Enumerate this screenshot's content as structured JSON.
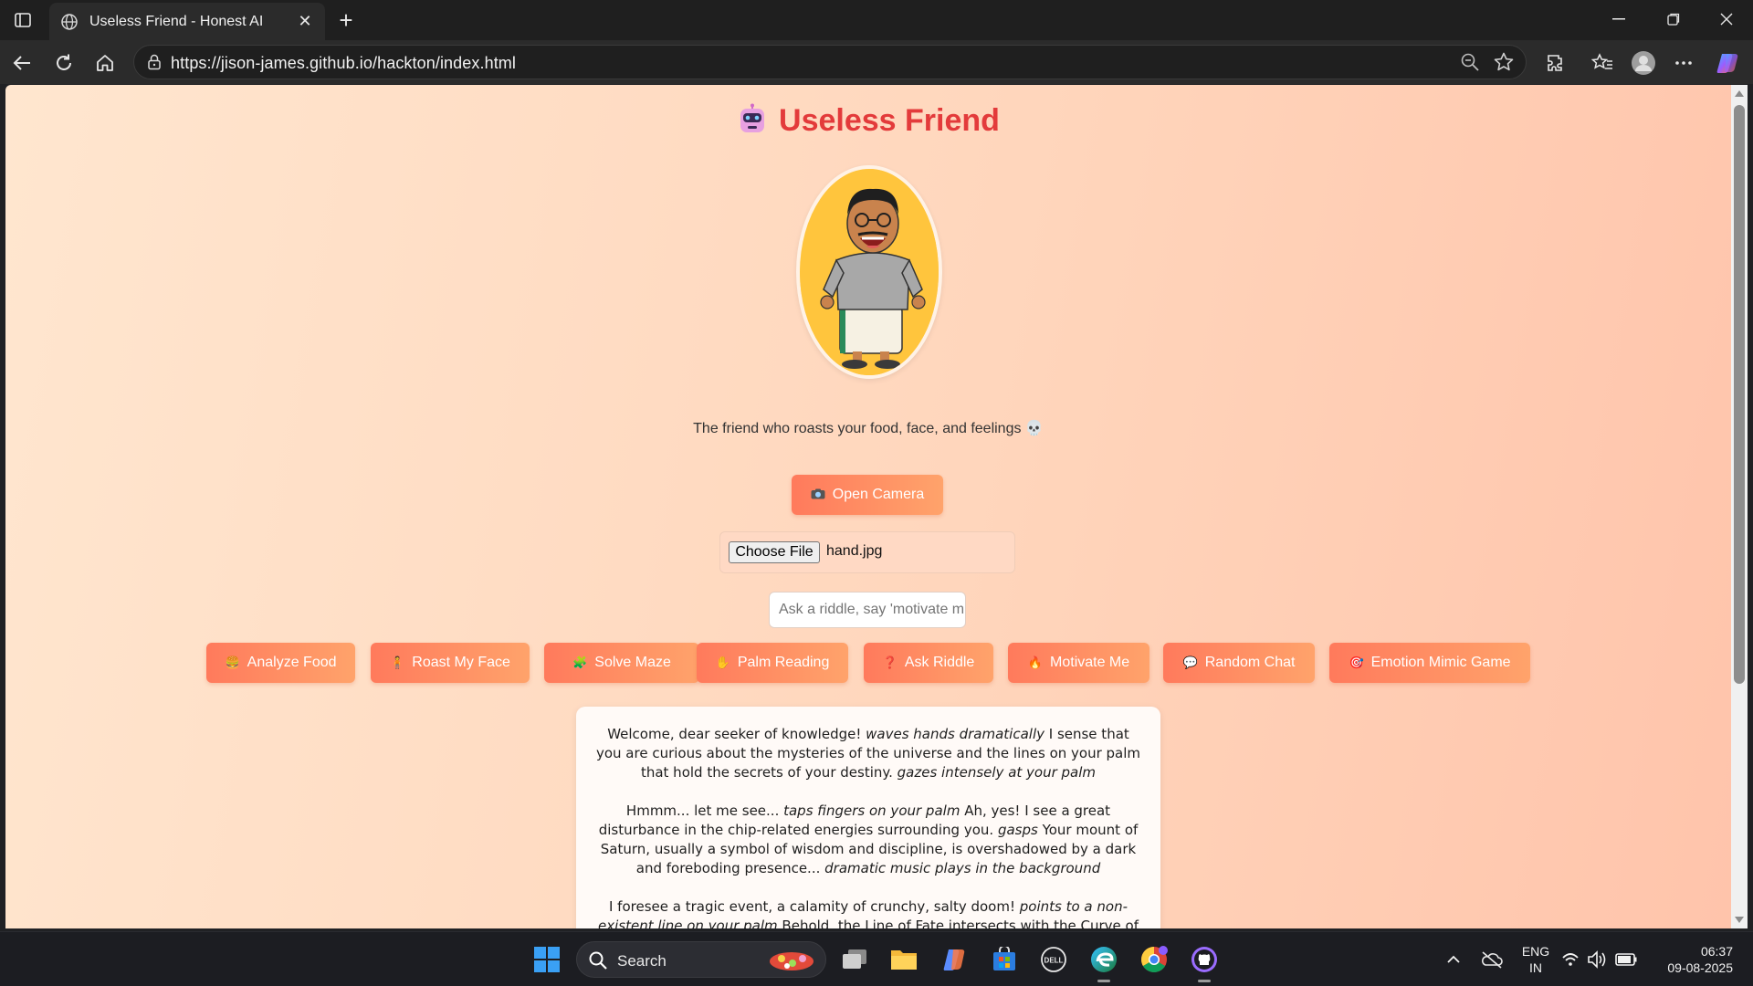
{
  "browser": {
    "tab_title": "Useless Friend - Honest AI",
    "url": "https://jison-james.github.io/hackton/index.html"
  },
  "page": {
    "title": "Useless Friend",
    "tagline": "The friend who roasts your food, face, and feelings 💀",
    "open_camera_label": "Open Camera",
    "open_camera_icon": "camera-icon",
    "file_button_label": "Choose File",
    "file_name": "hand.jpg",
    "input_value": "Ask a riddle, say 'motivate m",
    "actions": [
      {
        "label": "Analyze Food",
        "icon": "🍔"
      },
      {
        "label": "Roast My Face",
        "icon": "🧍"
      },
      {
        "label": "Solve Maze",
        "icon": "🧩"
      },
      {
        "label": "Palm Reading",
        "icon": "✋"
      },
      {
        "label": "Ask Riddle",
        "icon": "❓"
      },
      {
        "label": "Motivate Me",
        "icon": "🔥"
      },
      {
        "label": "Random Chat",
        "icon": "💬"
      },
      {
        "label": "Emotion Mimic Game",
        "icon": "🎯"
      }
    ],
    "response": {
      "p1_a": "Welcome, dear seeker of knowledge! ",
      "p1_b": "waves hands dramatically",
      "p1_c": " I sense that you are curious about the mysteries of the universe and the lines on your palm that hold the secrets of your destiny. ",
      "p1_d": "gazes intensely at your palm",
      "p2_a": "Hmmm... let me see... ",
      "p2_b": "taps fingers on your palm",
      "p2_c": " Ah, yes! I see a great disturbance in the chip-related energies surrounding you. ",
      "p2_d": "gasps",
      "p2_e": " Your mount of Saturn, usually a symbol of wisdom and discipline, is overshadowed by a dark and foreboding presence... ",
      "p2_f": "dramatic music plays in the background",
      "p3_a": "I foresee a tragic event, a calamity of crunchy, salty doom! ",
      "p3_b": "points to a non-existent line on your palm",
      "p3_c": " Behold, the Line of Fate intersects with the Curve of Crunchy"
    }
  },
  "taskbar": {
    "search_label": "Search",
    "lang_line1": "ENG",
    "lang_line2": "IN",
    "time": "06:37",
    "date": "09-08-2025"
  },
  "colors": {
    "title": "#e33b3b",
    "button_start": "#ff7a5c",
    "button_end": "#ffa36b",
    "background_start": "#ffe6cf",
    "background_end": "#ffc4ab"
  }
}
